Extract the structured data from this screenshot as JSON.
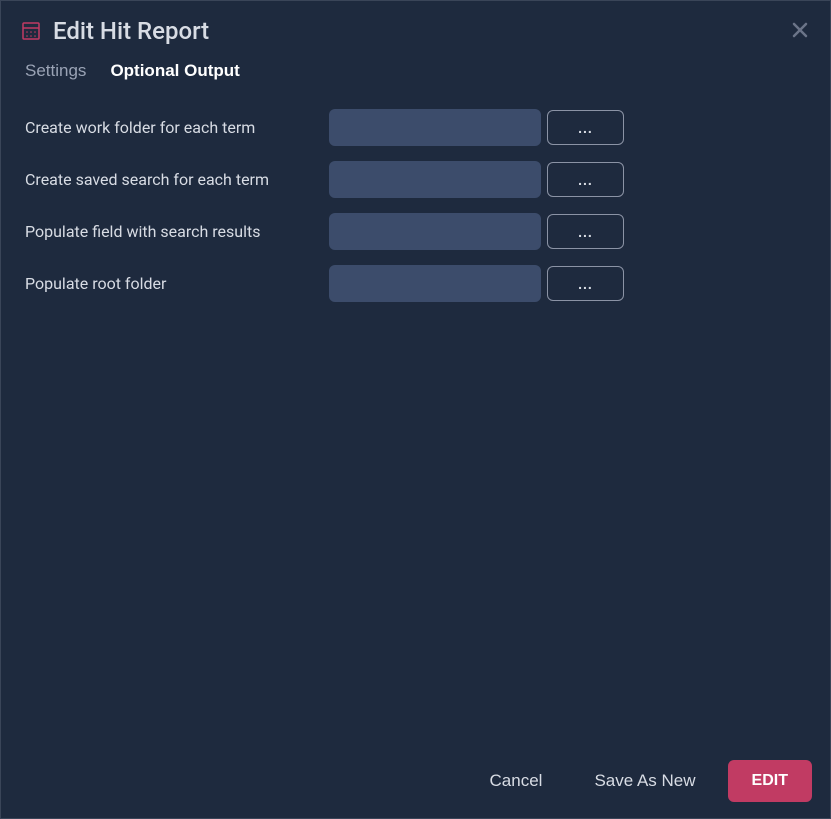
{
  "header": {
    "title": "Edit Hit Report"
  },
  "tabs": {
    "settings": "Settings",
    "optional_output": "Optional Output"
  },
  "fields": {
    "work_folder": {
      "label": "Create work folder for each term",
      "value": "",
      "browse": "..."
    },
    "saved_search": {
      "label": "Create saved search for each term",
      "value": "",
      "browse": "..."
    },
    "populate_field": {
      "label": "Populate field with search results",
      "value": "",
      "browse": "..."
    },
    "populate_root": {
      "label": "Populate root folder",
      "value": "",
      "browse": "..."
    }
  },
  "footer": {
    "cancel": "Cancel",
    "save_as_new": "Save As New",
    "edit": "EDIT"
  }
}
